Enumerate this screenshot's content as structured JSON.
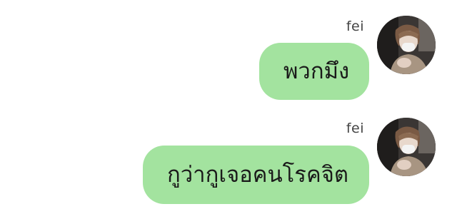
{
  "chat": {
    "messages": [
      {
        "sender": "fei",
        "text": "พวกมึง",
        "avatar_icon": "profile-photo"
      },
      {
        "sender": "fei",
        "text": "กูว่ากูเจอคนโรคจิต",
        "avatar_icon": "profile-photo"
      }
    ],
    "colors": {
      "bubble": "#a3e39f",
      "background": "#ffffff",
      "sender_text": "#444444"
    }
  }
}
